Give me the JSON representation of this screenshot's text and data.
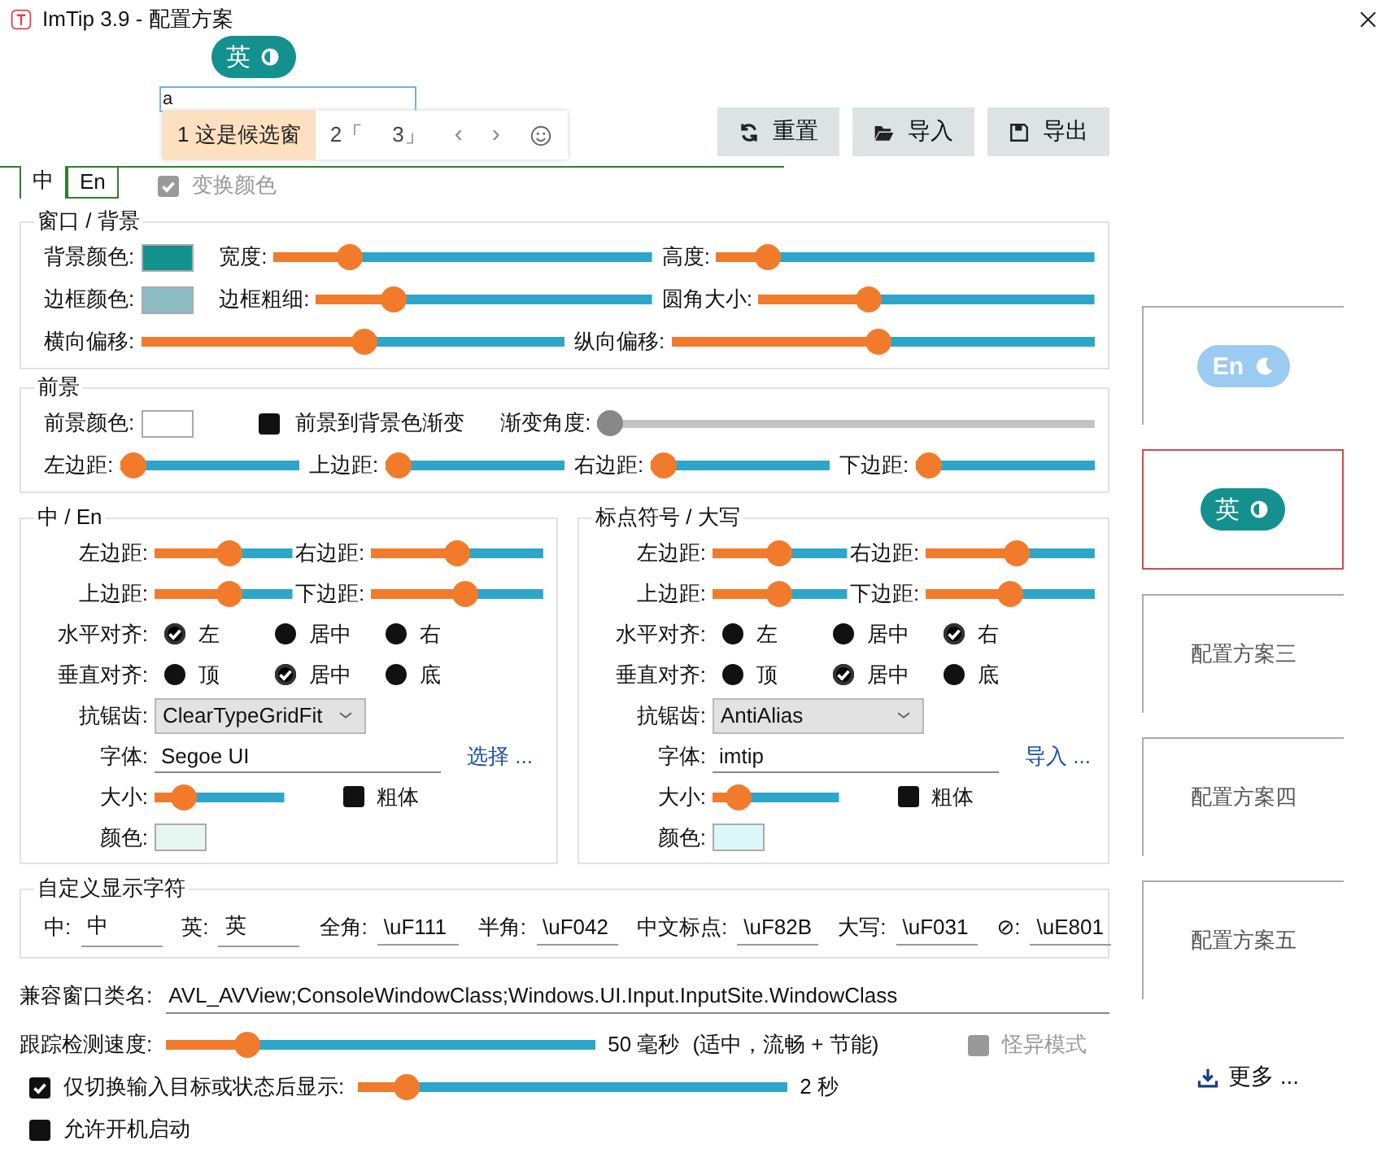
{
  "window": {
    "title": "ImTip 3.9 - 配置方案"
  },
  "preview_badge": {
    "text": "英"
  },
  "test_input": {
    "value": "a"
  },
  "candidate_window": {
    "candidates": [
      {
        "text": "1 这是候选窗",
        "selected": true
      },
      {
        "text": "2「",
        "selected": false
      },
      {
        "text": "3」",
        "selected": false
      }
    ],
    "prev": "‹",
    "next": "›"
  },
  "toolbar": [
    {
      "label": "重置"
    },
    {
      "label": "导入"
    },
    {
      "label": "导出"
    }
  ],
  "tabs": [
    {
      "label": "中",
      "selected": true
    },
    {
      "label": "En",
      "selected": false
    }
  ],
  "swap_colors": {
    "label": "变换颜色",
    "checked": true,
    "disabled": true
  },
  "sections": [
    {
      "title": "窗口 / 背景",
      "rows": [
        [
          {
            "kind": "swatch",
            "label": "背景颜色:",
            "color": "#13918e"
          },
          {
            "kind": "slider",
            "label": "宽度:",
            "level": 0.18
          },
          {
            "kind": "slider",
            "label": "高度:",
            "level": 0.11
          }
        ],
        [
          {
            "kind": "swatch",
            "label": "边框颜色:",
            "color": "#8dbbc4"
          },
          {
            "kind": "slider",
            "label": "边框粗细:",
            "level": 0.21
          },
          {
            "kind": "slider",
            "label": "圆角大小:",
            "level": 0.31
          }
        ],
        [
          {
            "kind": "slider",
            "label": "横向偏移:",
            "level": 0.53
          },
          {
            "kind": "slider",
            "label": "纵向偏移:",
            "level": 0.49
          }
        ]
      ]
    },
    {
      "title": "前景",
      "rows": [
        [
          {
            "kind": "swatch",
            "label": "前景颜色:",
            "color": "#ffffff"
          },
          {
            "kind": "check",
            "label": "前景到背景色渐变",
            "checked": false
          },
          {
            "kind": "slider",
            "label": "渐变角度:",
            "level": 0,
            "disabled": true
          }
        ],
        [
          {
            "kind": "slider",
            "label": "左边距:",
            "level": 0
          },
          {
            "kind": "slider",
            "label": "上边距:",
            "level": 0
          },
          {
            "kind": "slider",
            "label": "右边距:",
            "level": 0
          },
          {
            "kind": "slider",
            "label": "下边距:",
            "level": 0
          }
        ]
      ]
    }
  ],
  "side_by_side": [
    {
      "title": "中 / En",
      "rows": [
        [
          {
            "kind": "slider",
            "label": "左边距:",
            "level": 0.55
          },
          {
            "kind": "slider",
            "label": "右边距:",
            "level": 0.5
          }
        ],
        [
          {
            "kind": "slider",
            "label": "上边距:",
            "level": 0.55
          },
          {
            "kind": "slider",
            "label": "下边距:",
            "level": 0.55
          }
        ],
        [
          {
            "kind": "radio",
            "label": "水平对齐:",
            "options": [
              {
                "label": "左",
                "selected": true
              },
              {
                "label": "居中",
                "selected": false
              },
              {
                "label": "右",
                "selected": false
              }
            ]
          }
        ],
        [
          {
            "kind": "radio",
            "label": "垂直对齐:",
            "options": [
              {
                "label": "顶",
                "selected": false
              },
              {
                "label": "居中",
                "selected": true
              },
              {
                "label": "底",
                "selected": false
              }
            ]
          }
        ],
        [
          {
            "kind": "select",
            "label": "抗锯齿:",
            "value": "ClearTypeGridFit"
          }
        ],
        [
          {
            "kind": "text",
            "label": "字体:",
            "value": "Segoe UI",
            "link": "选择 ..."
          }
        ],
        [
          {
            "kind": "slider",
            "label": "大小:",
            "level": 0.16
          },
          {
            "kind": "check",
            "label": "粗体",
            "checked": false
          }
        ],
        [
          {
            "kind": "swatch",
            "label": "颜色:",
            "color": "#e6f6f1"
          }
        ]
      ]
    },
    {
      "title": "标点符号 / 大写",
      "rows": [
        [
          {
            "kind": "slider",
            "label": "左边距:",
            "level": 0.5
          },
          {
            "kind": "slider",
            "label": "右边距:",
            "level": 0.55
          }
        ],
        [
          {
            "kind": "slider",
            "label": "上边距:",
            "level": 0.5
          },
          {
            "kind": "slider",
            "label": "下边距:",
            "level": 0.5
          }
        ],
        [
          {
            "kind": "radio",
            "label": "水平对齐:",
            "options": [
              {
                "label": "左",
                "selected": false
              },
              {
                "label": "居中",
                "selected": false
              },
              {
                "label": "右",
                "selected": true
              }
            ]
          }
        ],
        [
          {
            "kind": "radio",
            "label": "垂直对齐:",
            "options": [
              {
                "label": "顶",
                "selected": false
              },
              {
                "label": "居中",
                "selected": true
              },
              {
                "label": "底",
                "selected": false
              }
            ]
          }
        ],
        [
          {
            "kind": "select",
            "label": "抗锯齿:",
            "value": "AntiAlias"
          }
        ],
        [
          {
            "kind": "text",
            "label": "字体:",
            "value": "imtip",
            "link": "导入 ..."
          }
        ],
        [
          {
            "kind": "slider",
            "label": "大小:",
            "level": 0.13
          },
          {
            "kind": "check",
            "label": "粗体",
            "checked": false
          }
        ],
        [
          {
            "kind": "swatch",
            "label": "颜色:",
            "color": "#dcf7fa"
          }
        ]
      ]
    }
  ],
  "custom_chars": {
    "title": "自定义显示字符",
    "fields": [
      {
        "label": "中:",
        "value": "中"
      },
      {
        "label": "英:",
        "value": "英"
      },
      {
        "label": "全角:",
        "value": "\\uF111"
      },
      {
        "label": "半角:",
        "value": "\\uF042"
      },
      {
        "label": "中文标点:",
        "value": "\\uF82B"
      },
      {
        "label": "大写:",
        "value": "\\uF031"
      },
      {
        "label": "⊘:",
        "value": "\\uE801"
      }
    ]
  },
  "compat_classes": {
    "label": "兼容窗口类名:",
    "value": "AVL_AVView;ConsoleWindowClass;Windows.UI.Input.InputSite.WindowClass"
  },
  "tracking": {
    "label": "跟踪检测速度:",
    "level": 0.17,
    "reading": "50 毫秒",
    "note": "(适中，流畅 + 节能)",
    "weird_mode": {
      "label": "怪异模式",
      "checked": false,
      "disabled": true
    }
  },
  "show_after_switch": {
    "label": "仅切换输入目标或状态后显示:",
    "checked": true,
    "level": 0.09,
    "reading": "2 秒"
  },
  "autostart": {
    "label": "允许开机启动",
    "checked": false
  },
  "schemes": [
    {
      "kind": "preview",
      "text": "En",
      "color": "#9ccbf1",
      "selected": false
    },
    {
      "kind": "preview",
      "text": "英",
      "color": "#14908e",
      "selected": true
    },
    {
      "kind": "name",
      "text": "配置方案三",
      "selected": false
    },
    {
      "kind": "name",
      "text": "配置方案四",
      "selected": false
    },
    {
      "kind": "name",
      "text": "配置方案五",
      "selected": false
    }
  ],
  "more": {
    "label": "更多 ..."
  }
}
